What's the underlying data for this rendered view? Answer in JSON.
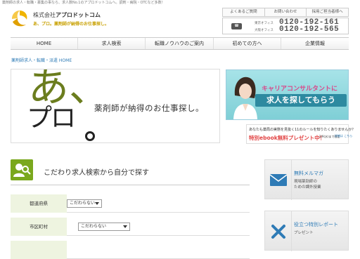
{
  "top_strip": "薬剤師の求人・転職・募集の事なら、求人数No.1のアプロドットコムへ。調剤・病院・OTCなど多数！",
  "logo": {
    "prefix": "株式会社",
    "name": "アプロドットコム",
    "tagline": "あ、プロ。薬剤師が納得のお仕事探し。"
  },
  "toplinks": [
    "よくあるご質問",
    "お問い合わせ",
    "採用ご担当者様へ"
  ],
  "phones": [
    {
      "office": "東京オフィス",
      "number": "0120-192-161"
    },
    {
      "office": "大阪オフィス",
      "number": "0120-192-565"
    }
  ],
  "nav": [
    {
      "label": "HOME"
    },
    {
      "label": "求人検索"
    },
    {
      "label": "転職ノウハウのご案内"
    },
    {
      "label": "初めての方へ"
    },
    {
      "label": "企業情報"
    }
  ],
  "breadcrumb": "薬剤師求人・転職・派遣 HOME",
  "hero": {
    "a": "あ、",
    "pro": "プロ",
    "sub": "薬剤師が納得のお仕事探し。"
  },
  "consultant_banner": {
    "line1": "キャリアコンサルタントに",
    "line2": "求人を探してもらう"
  },
  "ebook_banner": {
    "line1": "あなたも薬局の実態を見抜く11のルールを知りたくありませんか？",
    "line2": "特別ebook無料プレゼント中！",
    "date": "2/9(水)まで限定",
    "link": "詳細は こちら"
  },
  "search": {
    "title": "こだわり求人検索から自分で探す"
  },
  "form": [
    {
      "label": "都道府県",
      "value": "こだわらない"
    },
    {
      "label": "市区町村",
      "value": "こだわらない"
    }
  ],
  "side": [
    {
      "title": "無料メルマガ",
      "sub1": "現場薬剤師の",
      "sub2": "ための課外授業"
    },
    {
      "title": "役立つ特別レポート",
      "sub1": "プレゼント",
      "sub2": ""
    }
  ]
}
